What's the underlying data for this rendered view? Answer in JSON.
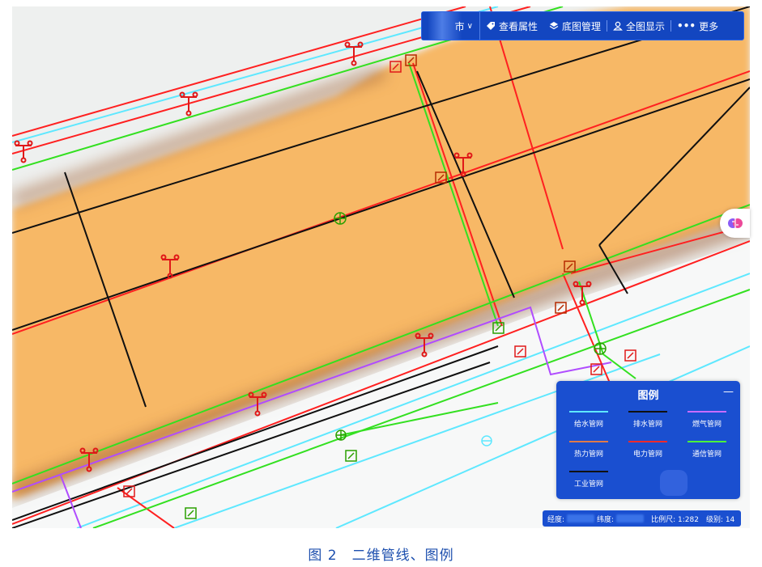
{
  "toolbar": {
    "city": "市",
    "view_attributes": "查看属性",
    "basemap_manage": "底图管理",
    "full_view": "全图显示",
    "more": "更多"
  },
  "legend": {
    "title": "图例",
    "minimize": "—",
    "items": [
      {
        "label": "给水管网",
        "color": "#5ee8ff"
      },
      {
        "label": "排水管网",
        "color": "#101010"
      },
      {
        "label": "燃气管网",
        "color": "#c86cff"
      },
      {
        "label": "热力管网",
        "color": "#e07a4a"
      },
      {
        "label": "电力管网",
        "color": "#ff2a2a"
      },
      {
        "label": "通信管网",
        "color": "#4cff3a"
      },
      {
        "label": "工业管网",
        "color": "#101010"
      }
    ]
  },
  "status": {
    "lng_label": "经度:",
    "lat_label": "纬度:",
    "scale": "比例尺: 1:282",
    "level": "级别: 14"
  },
  "caption": "图 2　二维管线、图例",
  "colors": {
    "land": "#f7b866",
    "panel": "#1a4fd0",
    "water": "#5ee8ff",
    "power": "#ff2020",
    "telecom": "#33e020",
    "drain": "#101010",
    "gas": "#b04cff"
  }
}
